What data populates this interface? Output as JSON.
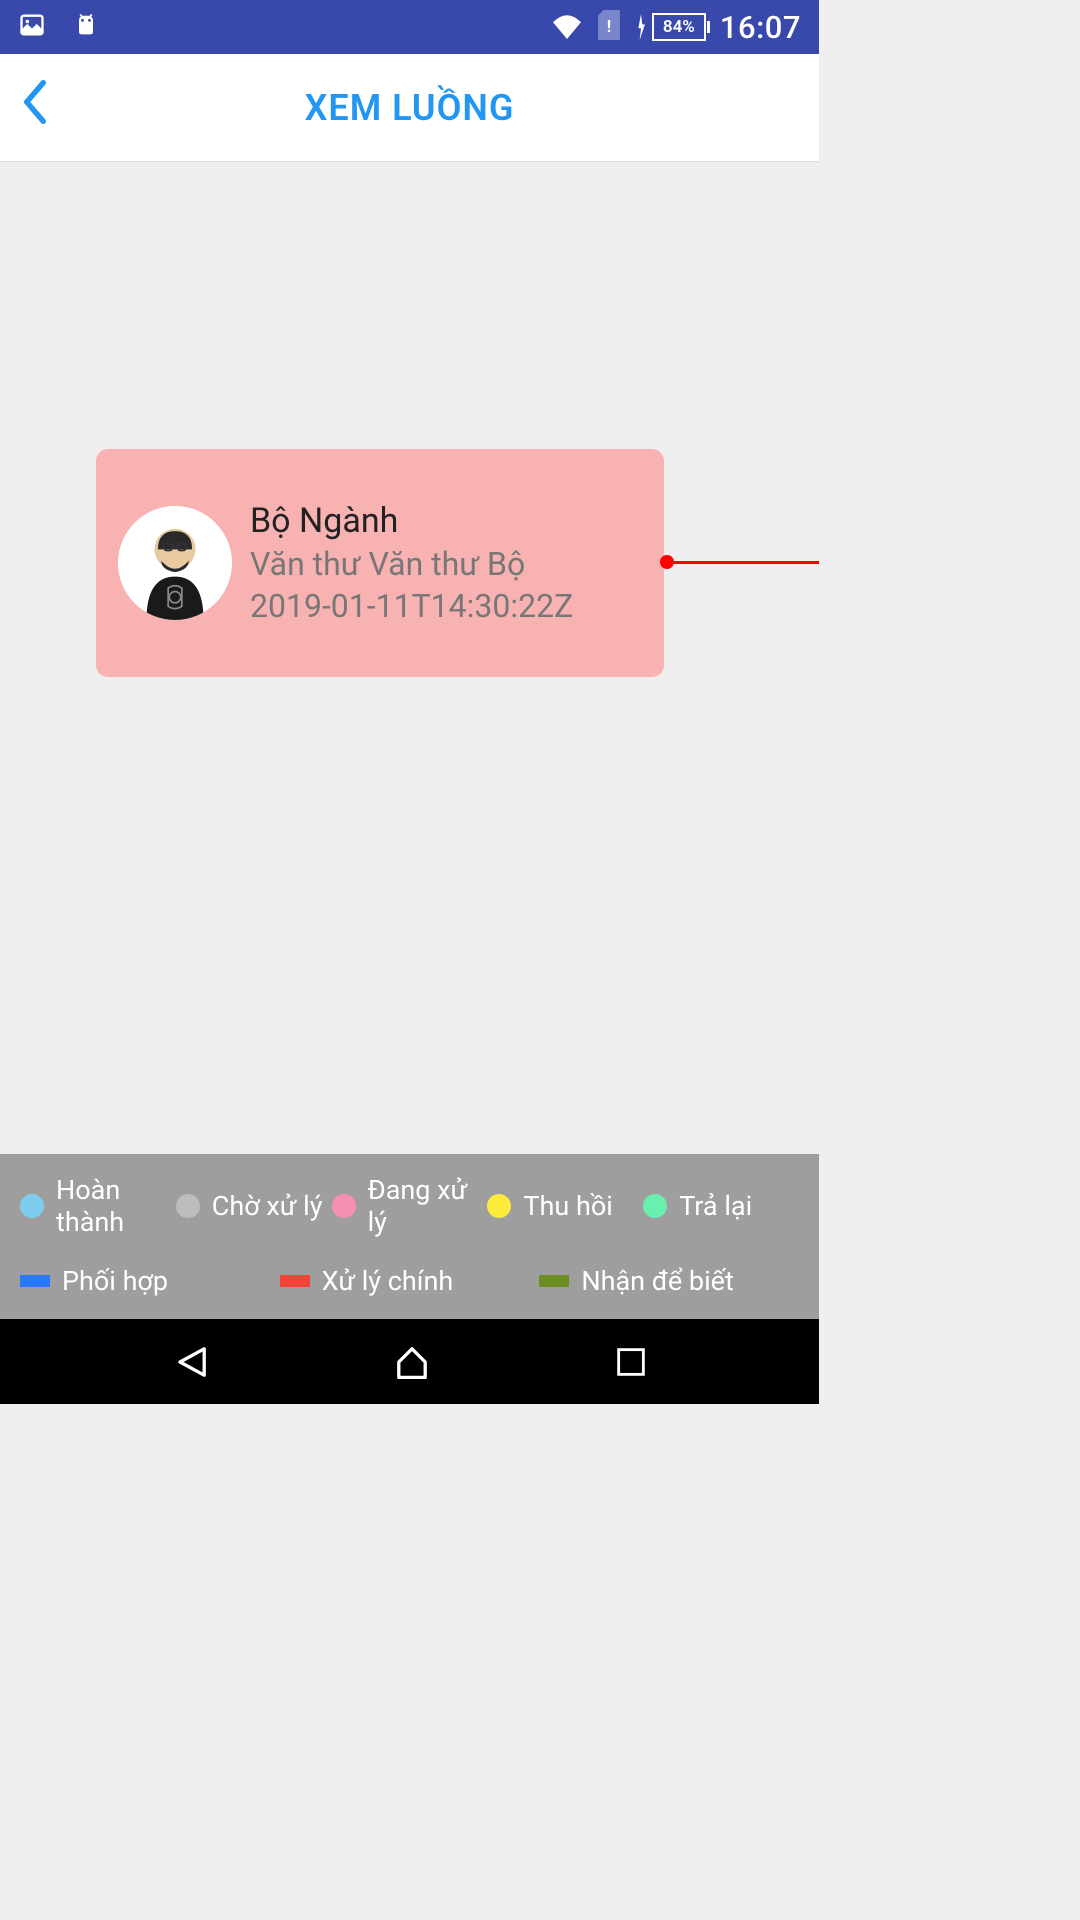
{
  "status": {
    "time": "16:07",
    "battery": "84%"
  },
  "header": {
    "title": "XEM LUỒNG"
  },
  "flow_card": {
    "title": "Bộ Ngành",
    "subtitle": "Văn thư Văn thư Bộ",
    "timestamp": "2019-01-11T14:30:22Z"
  },
  "legend": {
    "row1": [
      {
        "color": "c-blue-light",
        "label": "Hoàn thành"
      },
      {
        "color": "c-grey",
        "label": "Chờ xử lý"
      },
      {
        "color": "c-pink",
        "label": "Đang xử lý"
      },
      {
        "color": "c-yellow",
        "label": "Thu hồi"
      },
      {
        "color": "c-green",
        "label": "Trả lại"
      }
    ],
    "row2": [
      {
        "color": "c-blue",
        "label": "Phối hợp"
      },
      {
        "color": "c-red",
        "label": "Xử lý chính"
      },
      {
        "color": "c-olive",
        "label": "Nhận để biết"
      }
    ]
  }
}
